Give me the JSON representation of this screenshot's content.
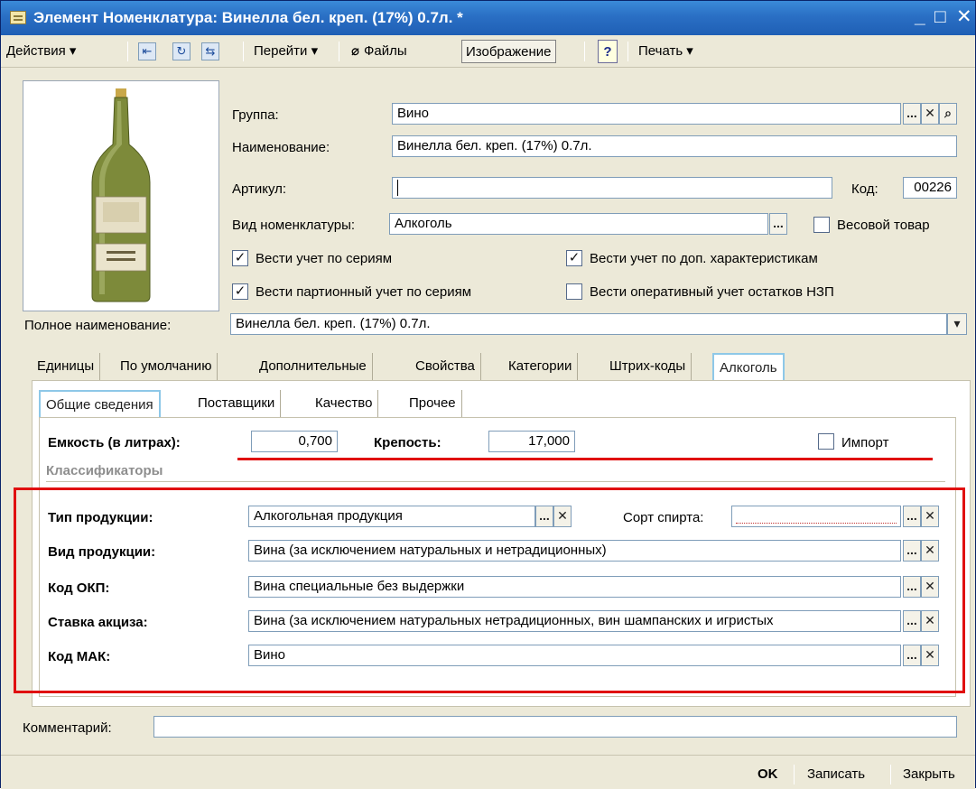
{
  "window": {
    "title": "Элемент Номенклатура: Винелла бел. креп. (17%) 0.7л. *",
    "minimize": "_",
    "maximize": "□",
    "close": "✕"
  },
  "toolbar": {
    "actions": "Действия ▾",
    "goto": "Перейти ▾",
    "files": "Файлы",
    "image": "Изображение",
    "help": "?",
    "print": "Печать ▾"
  },
  "form": {
    "group_label": "Группа:",
    "group_value": "Вино",
    "name_label": "Наименование:",
    "name_value": "Винелла бел. креп. (17%) 0.7л.",
    "article_label": "Артикул:",
    "article_value": "",
    "code_label": "Код:",
    "code_value": "00226",
    "kind_label": "Вид номенклатуры:",
    "kind_value": "Алкоголь",
    "weight_label": "Весовой товар",
    "series_label": "Вести учет по сериям",
    "extra_label": "Вести учет по доп.  характеристикам",
    "batch_label": "Вести партионный учет по сериям",
    "nzp_label": "Вести оперативный учет остатков НЗП",
    "fullname_label": "Полное наименование:",
    "fullname_value": "Винелла бел. креп. (17%) 0.7л."
  },
  "tabs": [
    "Единицы",
    "По умолчанию",
    "Дополнительные",
    "Свойства",
    "Категории",
    "Штрих-коды",
    "Алкоголь"
  ],
  "subtabs": [
    "Общие сведения",
    "Поставщики",
    "Качество",
    "Прочее"
  ],
  "alcohol": {
    "capacity_label": "Емкость (в литрах):",
    "capacity_value": "0,700",
    "strength_label": "Крепость:",
    "strength_value": "17,000",
    "import_label": "Импорт",
    "classifiers_label": "Классификаторы",
    "type_label": "Тип продукции:",
    "type_value": "Алкогольная продукция",
    "spirit_label": "Сорт спирта:",
    "spirit_value": "",
    "prodkind_label": "Вид продукции:",
    "prodkind_value": "Вина (за исключением натуральных и нетрадиционных)",
    "okp_label": "Код ОКП:",
    "okp_value": "Вина специальные без выдержки",
    "excise_label": "Ставка акциза:",
    "excise_value": "Вина (за исключением натуральных нетрадиционных, вин шампанских и игристых",
    "mak_label": "Код МАК:",
    "mak_value": "Вино"
  },
  "comment_label": "Комментарий:",
  "comment_value": "",
  "footer": {
    "ok": "OK",
    "save": "Записать",
    "close": "Закрыть"
  },
  "colors": {
    "highlight": "#e01010",
    "title_bar": "#2a6fc4",
    "active_tab_border": "#8ec8e8"
  }
}
